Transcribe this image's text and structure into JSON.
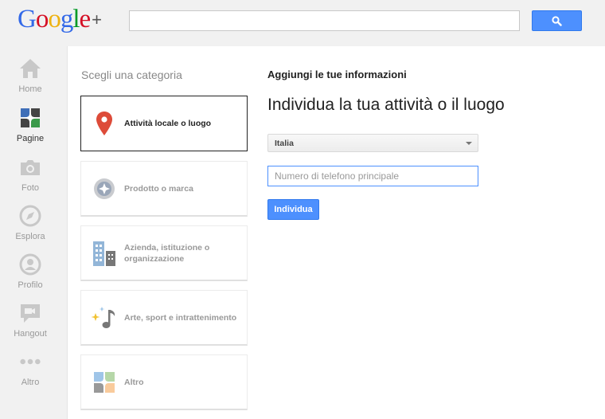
{
  "logo": {
    "g1": "G",
    "o1": "o",
    "o2": "o",
    "g2": "g",
    "l": "l",
    "e": "e",
    "plus": "+"
  },
  "search": {
    "value": "",
    "button_icon": "search-icon"
  },
  "nav": {
    "items": [
      {
        "label": "Home",
        "icon": "home-icon"
      },
      {
        "label": "Pagine",
        "icon": "pages-icon"
      },
      {
        "label": "Foto",
        "icon": "camera-icon"
      },
      {
        "label": "Esplora",
        "icon": "compass-icon"
      },
      {
        "label": "Profilo",
        "icon": "profile-icon"
      },
      {
        "label": "Hangout",
        "icon": "video-icon"
      },
      {
        "label": "Altro",
        "icon": "more-dots-icon"
      }
    ],
    "active": "Pagine"
  },
  "categories": {
    "title": "Scegli una categoria",
    "items": [
      {
        "label": "Attività locale o luogo",
        "icon": "map-pin-icon",
        "selected": true
      },
      {
        "label": "Prodotto o marca",
        "icon": "product-tag-icon",
        "selected": false
      },
      {
        "label": "Azienda, istituzione o organizzazione",
        "icon": "buildings-icon",
        "selected": false
      },
      {
        "label": "Arte, sport e intrattenimento",
        "icon": "music-note-icon",
        "selected": false
      },
      {
        "label": "Altro",
        "icon": "other-grid-icon",
        "selected": false
      }
    ]
  },
  "form": {
    "heading": "Aggiungi le tue informazioni",
    "title": "Individua la tua attività o il luogo",
    "country": "Italia",
    "phone_value": "",
    "phone_placeholder": "Numero di telefono principale",
    "submit_label": "Individua"
  },
  "colors": {
    "accent": "#4d90fe",
    "logo_blue": "#3369e8",
    "logo_red": "#d50f25",
    "logo_yellow": "#eeb211",
    "logo_green": "#009925",
    "pin_red": "#dd4b39"
  }
}
